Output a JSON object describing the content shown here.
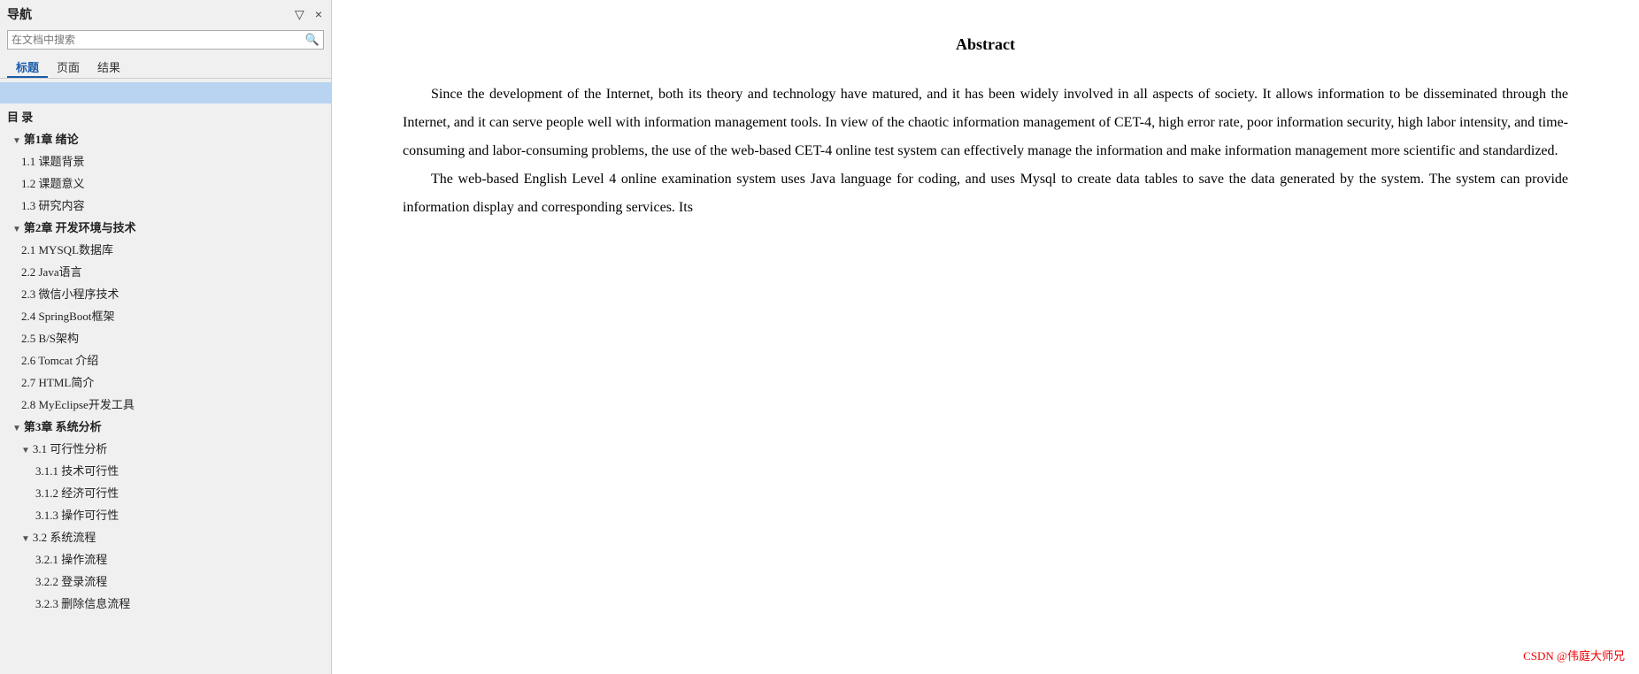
{
  "sidebar": {
    "title": "导航",
    "collapse_label": "▽",
    "close_label": "×",
    "search": {
      "placeholder": "在文档中搜索",
      "icon": "🔍"
    },
    "tabs": [
      {
        "label": "标题",
        "active": true
      },
      {
        "label": "页面",
        "active": false
      },
      {
        "label": "结果",
        "active": false
      }
    ],
    "toc": [
      {
        "level": 0,
        "text": "目 录",
        "has_triangle": false
      },
      {
        "level": 1,
        "text": "第1章 绪论",
        "has_triangle": true,
        "expanded": true
      },
      {
        "level": 2,
        "text": "1.1 课题背景",
        "has_triangle": false
      },
      {
        "level": 2,
        "text": "1.2 课题意义",
        "has_triangle": false
      },
      {
        "level": 2,
        "text": "1.3 研究内容",
        "has_triangle": false
      },
      {
        "level": 1,
        "text": "第2章 开发环境与技术",
        "has_triangle": true,
        "expanded": true
      },
      {
        "level": 2,
        "text": "2.1 MYSQL数据库",
        "has_triangle": false
      },
      {
        "level": 2,
        "text": "2.2 Java语言",
        "has_triangle": false
      },
      {
        "level": 2,
        "text": "2.3 微信小程序技术",
        "has_triangle": false
      },
      {
        "level": 2,
        "text": "2.4 SpringBoot框架",
        "has_triangle": false
      },
      {
        "level": 2,
        "text": "2.5 B/S架构",
        "has_triangle": false
      },
      {
        "level": 2,
        "text": "2.6 Tomcat 介绍",
        "has_triangle": false
      },
      {
        "level": 2,
        "text": "2.7 HTML简介",
        "has_triangle": false
      },
      {
        "level": 2,
        "text": "2.8 MyEclipse开发工具",
        "has_triangle": false
      },
      {
        "level": 1,
        "text": "第3章 系统分析",
        "has_triangle": true,
        "expanded": true
      },
      {
        "level": 2,
        "text": "3.1 可行性分析",
        "has_triangle": true,
        "expanded": true
      },
      {
        "level": 3,
        "text": "3.1.1 技术可行性",
        "has_triangle": false
      },
      {
        "level": 3,
        "text": "3.1.2 经济可行性",
        "has_triangle": false
      },
      {
        "level": 3,
        "text": "3.1.3 操作可行性",
        "has_triangle": false
      },
      {
        "level": 2,
        "text": "3.2 系统流程",
        "has_triangle": true,
        "expanded": true
      },
      {
        "level": 3,
        "text": "3.2.1 操作流程",
        "has_triangle": false
      },
      {
        "level": 3,
        "text": "3.2.2 登录流程",
        "has_triangle": false
      },
      {
        "level": 3,
        "text": "3.2.3 删除信息流程",
        "has_triangle": false
      }
    ]
  },
  "main": {
    "abstract_title": "Abstract",
    "paragraphs": [
      "Since the development of the Internet, both its theory and technology have matured, and it has been widely involved in all aspects of society. It allows information to be disseminated through the Internet, and it can serve people well with information management tools. In view of the chaotic information management of CET-4, high error rate, poor information security, high labor intensity, and time-consuming and labor-consuming problems, the use of the web-based CET-4 online test system can effectively manage the information and make information management more scientific and standardized.",
      "The web-based English Level 4 online examination system uses Java language for coding, and uses Mysql to create data tables to save the data generated by the system. The system can provide information display and corresponding services. Its"
    ]
  },
  "watermark": {
    "text": "CSDN @伟庭大师兄"
  }
}
